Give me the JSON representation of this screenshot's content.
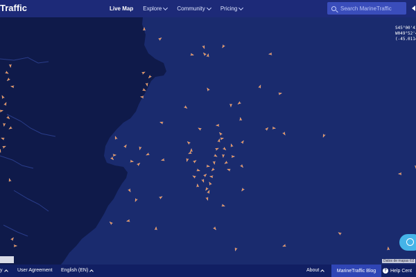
{
  "header": {
    "logo_text": "Traffic",
    "nav": [
      {
        "label": "Live Map",
        "active": true
      },
      {
        "label": "Explore"
      },
      {
        "label": "Community"
      },
      {
        "label": "Pricing"
      }
    ],
    "search_placeholder": "Search MarineTraffic"
  },
  "map": {
    "coords": {
      "lat": "S45°00'41.",
      "lon": "W049°52'4",
      "decimal": "(-45.0114, "
    },
    "attribution": "Datos de mapas ©2",
    "colors": {
      "ocean": "#1a2b6e",
      "land": "#0f1a4a",
      "vessel": "#f08a4b"
    }
  },
  "footer": {
    "left_partial": "y",
    "user_agreement": "User Agreement",
    "language": "English (EN)",
    "about": "About",
    "blog": "MarineTraffic Blog",
    "help": "Help Cent"
  }
}
